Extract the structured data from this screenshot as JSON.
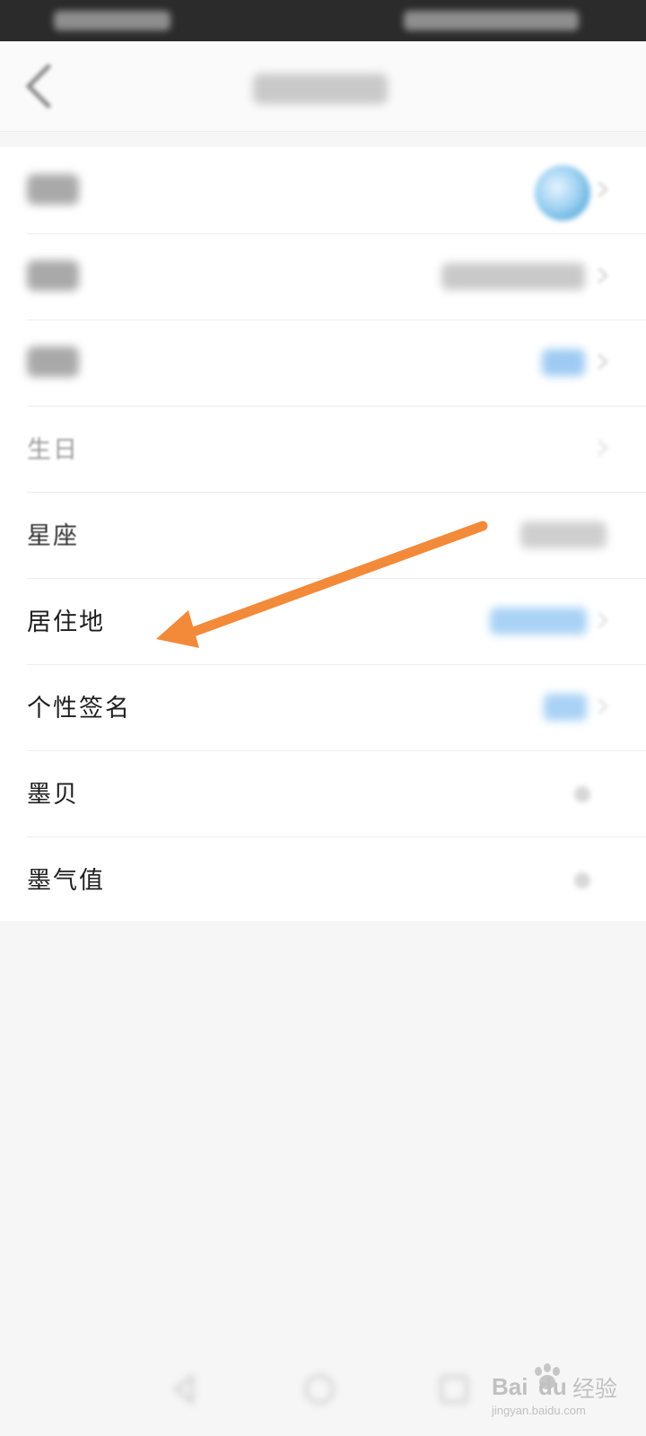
{
  "rows": [
    {
      "label": "星座"
    },
    {
      "label": "居住地"
    },
    {
      "label": "个性签名"
    },
    {
      "label": "墨贝"
    },
    {
      "label": "墨气值"
    }
  ],
  "blurred_rows": [
    {
      "label": "生日"
    }
  ],
  "annotation": {
    "color": "#f28a3a"
  },
  "watermark": {
    "brand": "Bai",
    "brand2": "du",
    "cn": "经验",
    "url": "jingyan.baidu.com"
  },
  "colors": {
    "accent_blue": "#8fc6f3",
    "text": "#1e1e1e",
    "status_bar": "#2b2b2b"
  }
}
